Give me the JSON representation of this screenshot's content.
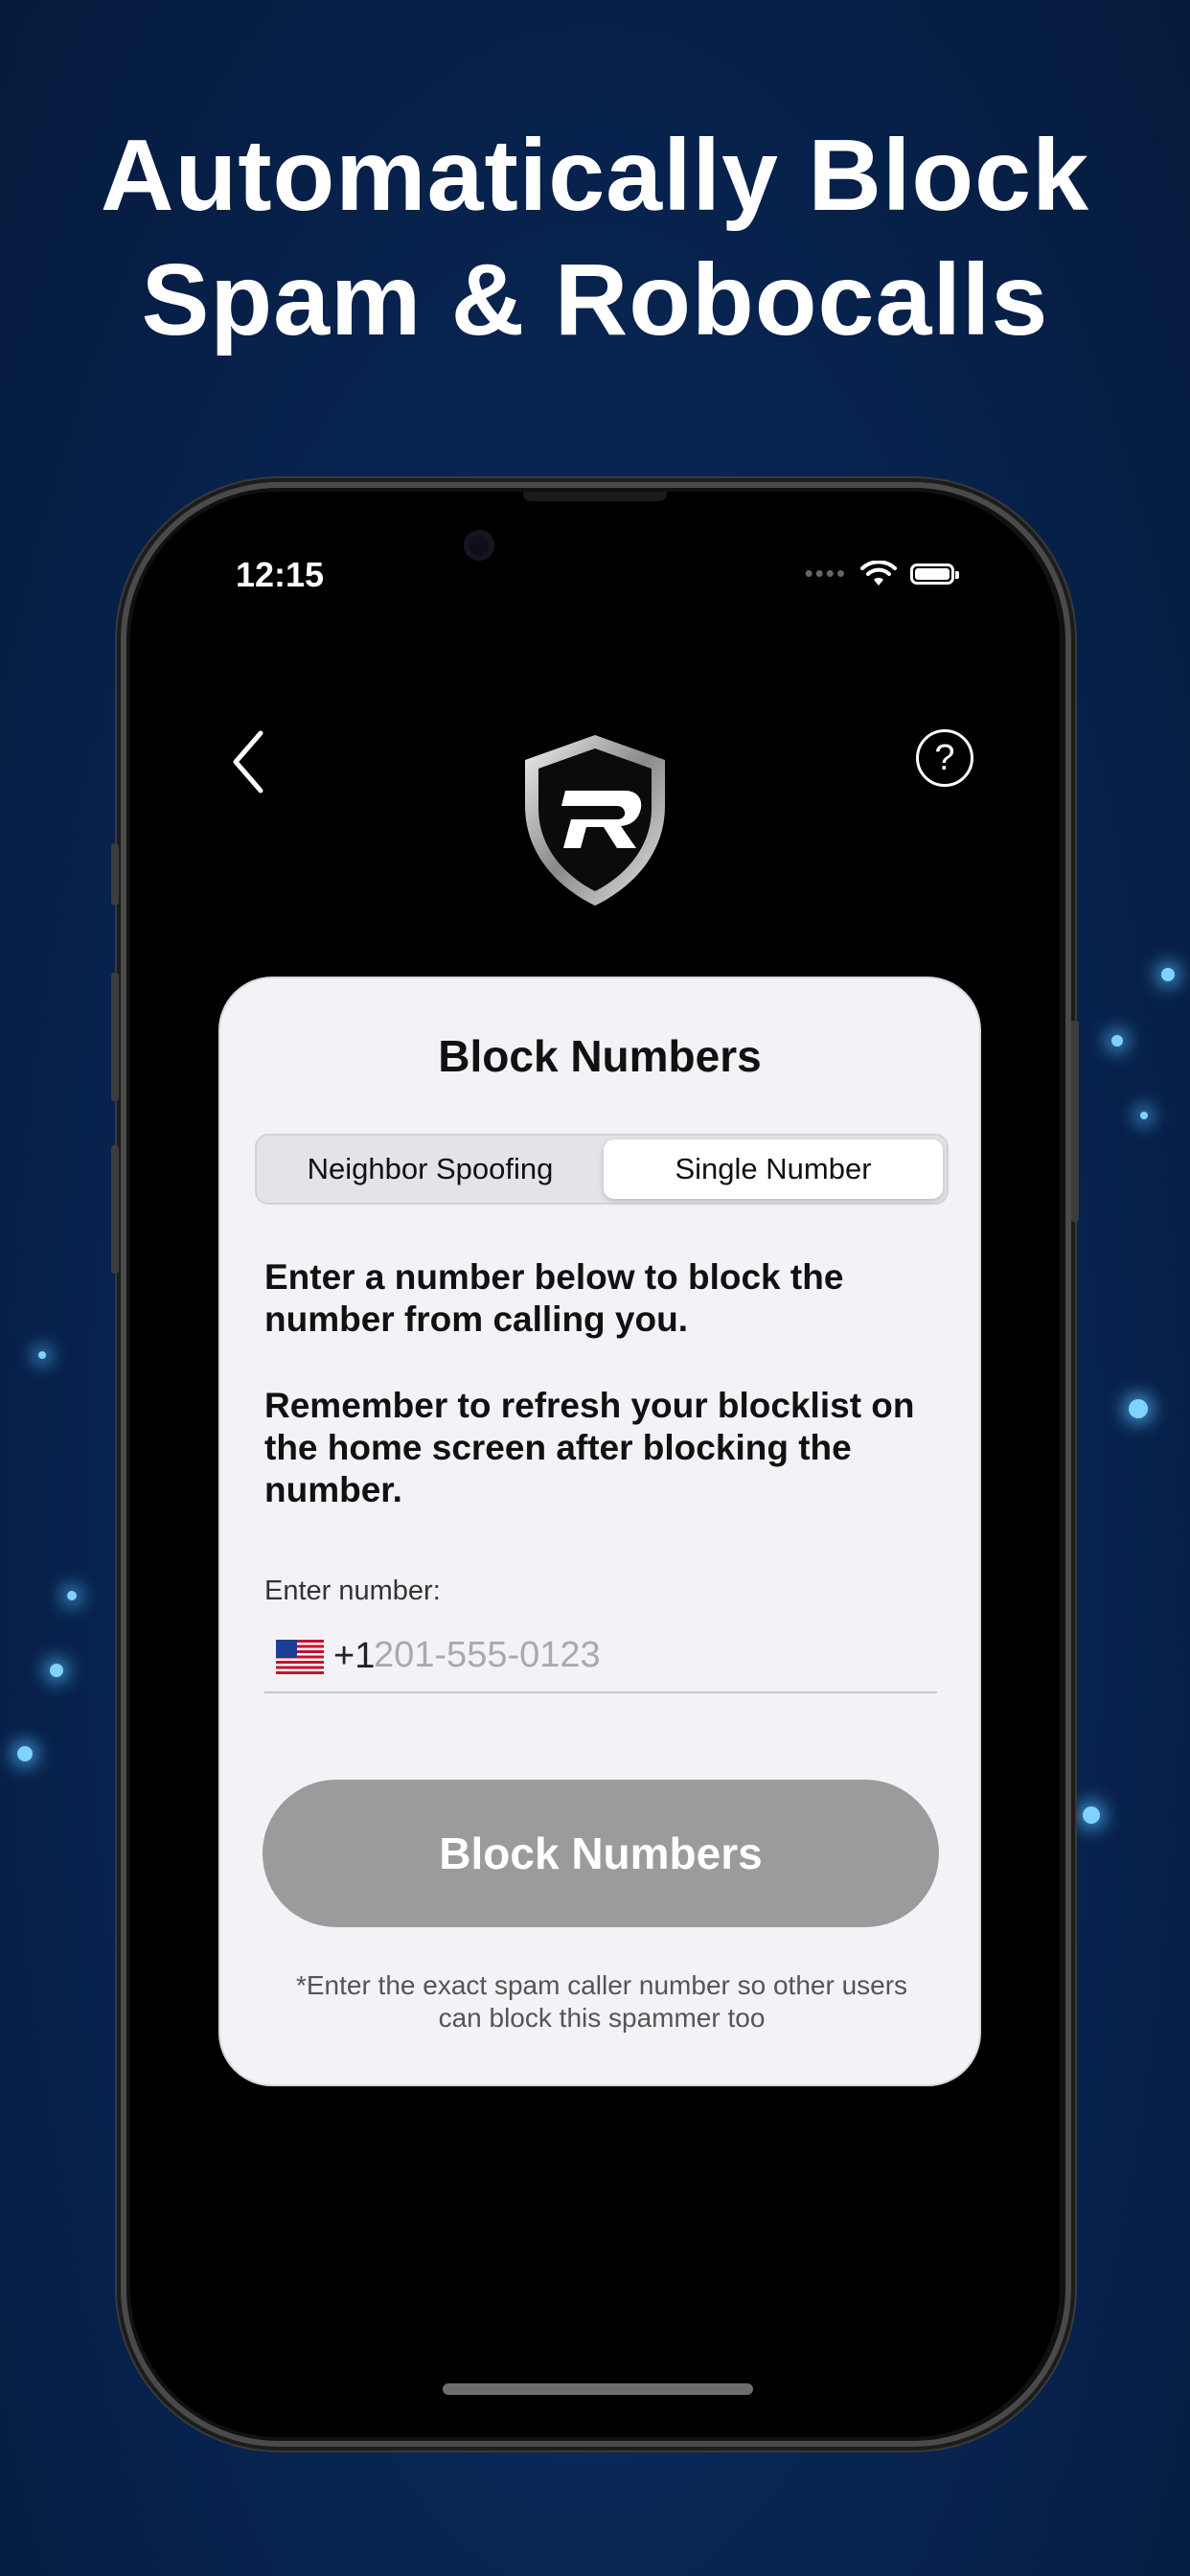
{
  "headline": {
    "line1": "Automatically Block",
    "line2": "Spam & Robocalls"
  },
  "status_bar": {
    "time": "12:15",
    "icons": [
      "signal-dots-icon",
      "wifi-icon",
      "battery-icon"
    ]
  },
  "nav": {
    "back_icon": "chevron-left-icon",
    "help_icon": "question-mark-icon",
    "help_glyph": "?",
    "logo": "shield-r-logo"
  },
  "card": {
    "title": "Block Numbers",
    "segments": [
      "Neighbor Spoofing",
      "Single Number"
    ],
    "selected_segment": "Single Number",
    "paragraph1": "Enter a number below to block the number from calling you.",
    "paragraph2": "Remember to refresh your blocklist on the home screen after blocking the number.",
    "field_label": "Enter number:",
    "country_flag": "us-flag-icon",
    "country_code": "+1",
    "number_value": "",
    "number_placeholder": "201-555-0123",
    "button_label": "Block Numbers",
    "footnote": "*Enter the exact spam caller number so other users can block this spammer too"
  },
  "colors": {
    "background": "#082654",
    "card_background": "#f2f2f7",
    "button_disabled": "#9b9b9b",
    "headline_text": "#ffffff"
  }
}
